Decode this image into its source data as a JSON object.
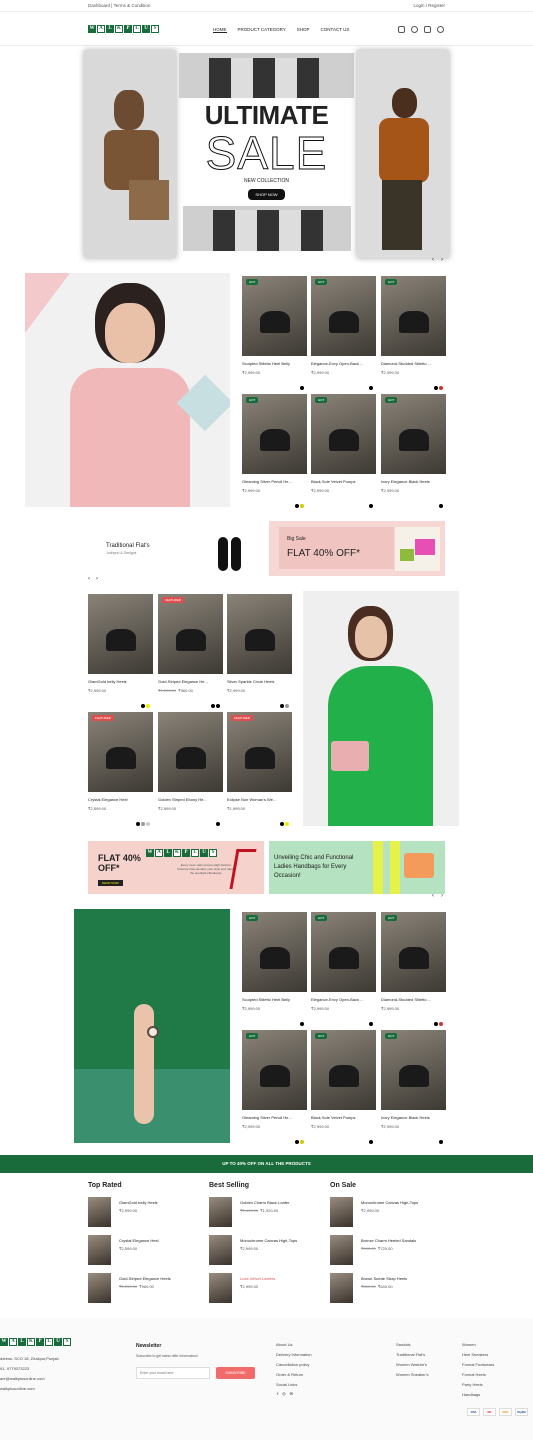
{
  "topbar": {
    "left": "Dashboard | Terms & Condition",
    "right": "Login / Register"
  },
  "brand": {
    "letters": [
      "W",
      "A",
      "L",
      "K",
      "P",
      "L",
      "U",
      "S"
    ]
  },
  "nav": [
    "HOME",
    "PRODUCT CATEGORY",
    "SHOP",
    "CONTACT US"
  ],
  "hero": {
    "title": "ULTIMATE",
    "title2": "SALE",
    "subtitle": "NEW COLLECTION",
    "cta": "SHOP NOW"
  },
  "products1": [
    {
      "name": "Sculpted Stiletto Heel Belly",
      "price": "₹2,999.00",
      "badge": "HOT",
      "dots": [
        "#000"
      ]
    },
    {
      "name": "Elegance-Envy Open-Back ...",
      "price": "₹2,999.00",
      "badge": "HOT",
      "dots": [
        "#000"
      ]
    },
    {
      "name": "Diamond-Studded Stiletto ...",
      "price": "₹2,999.00",
      "badge": "HOT",
      "dots": [
        "#000",
        "#c33"
      ]
    },
    {
      "name": "Gleaming Silver Pencil He...",
      "price": "₹2,999.00",
      "badge": "HOT",
      "dots": [
        "#000",
        "#cc0"
      ]
    },
    {
      "name": "Black Sole Velvet Pumps",
      "price": "₹2,999.00",
      "badge": "HOT",
      "dots": [
        "#000"
      ]
    },
    {
      "name": "Ivory Elegance Black Heels",
      "price": "₹2,999.00",
      "badge": "HOT",
      "dots": [
        "#000"
      ]
    }
  ],
  "flats": {
    "title": "Traditional Flat's",
    "subtitle": "Jodhpuri & Designs"
  },
  "bigsale": {
    "title": "Big Sale",
    "offer": "FLAT 40% OFF*"
  },
  "products2": [
    {
      "name": "GlamGold belly Heels",
      "price": "₹2,999.00",
      "badge": "",
      "dots": [
        "#000",
        "#ee0"
      ]
    },
    {
      "name": "Gold-Striped Elegance He...",
      "old": "₹1,200.00",
      "price": "₹960.00",
      "badge": "FEATURED",
      "dots": [
        "#000",
        "#000"
      ]
    },
    {
      "name": "Silver Sparkle Circle Heels",
      "price": "₹2,999.00",
      "badge": "",
      "dots": [
        "#000",
        "#999"
      ]
    },
    {
      "name": "Crystal Elegance Heel",
      "price": "₹2,599.00",
      "badge": "FEATURED",
      "dots": [
        "#000",
        "#999",
        "#ccc"
      ]
    },
    {
      "name": "Golden Striped Ebony He...",
      "price": "₹2,999.00",
      "badge": "",
      "dots": [
        "#000"
      ]
    },
    {
      "name": "Eclipse Noir Woman's We...",
      "price": "₹1,999.00",
      "badge": "FEATURED",
      "dots": [
        "#000",
        "#ee0"
      ]
    }
  ],
  "promo1": {
    "offer": "FLAT 40% OFF*",
    "desc": "Every heel: Harmonious High Fashion footwear that elevates your style and raises the spotlight effortlessly.",
    "cta": "SHOP NOW"
  },
  "promo2": {
    "text": "Unveiling Chic and Functional Ladies Handbags for Every Occasion!",
    "tag": "SHOP NOW"
  },
  "products3": [
    {
      "name": "Sculpted Stiletto Heel Belly",
      "price": "₹2,999.00",
      "badge": "HOT",
      "dots": [
        "#000"
      ]
    },
    {
      "name": "Elegance-Envy Open-Back ...",
      "price": "₹2,999.00",
      "badge": "HOT",
      "dots": [
        "#000"
      ]
    },
    {
      "name": "Diamond-Studded Stiletto ...",
      "price": "₹2,999.00",
      "badge": "HOT",
      "dots": [
        "#000",
        "#c33"
      ]
    },
    {
      "name": "Gleaming Silver Pencil He...",
      "price": "₹2,999.00",
      "badge": "HOT",
      "dots": [
        "#000",
        "#cc0"
      ]
    },
    {
      "name": "Black Sole Velvet Pumps",
      "price": "₹2,999.00",
      "badge": "HOT",
      "dots": [
        "#000"
      ]
    },
    {
      "name": "Ivory Elegance Black Heels",
      "price": "₹2,999.00",
      "badge": "HOT",
      "dots": [
        "#000"
      ]
    }
  ],
  "banner": "UP TO 40% OFF ON ALL THE PRODUCTS",
  "top_rated": {
    "title": "Top Rated",
    "items": [
      {
        "n": "GlamGold belly Heels",
        "p": "₹2,999.00",
        "o": ""
      },
      {
        "n": "Crystal Elegance Heel",
        "p": "₹2,599.00",
        "o": ""
      },
      {
        "n": "Gold-Striped Elegance Heels",
        "p": "₹960.00",
        "o": "₹1,200.00"
      }
    ]
  },
  "best_selling": {
    "title": "Best Selling",
    "items": [
      {
        "n": "Golden Charm Black Loafer",
        "p": "₹1,920.00",
        "o": "₹2,400.00"
      },
      {
        "n": "Monochrome Canvas High-Tops",
        "p": "₹2,999.00",
        "o": ""
      },
      {
        "n": "Luxe Velvet Loafers",
        "p": "₹2,999.00",
        "o": ""
      }
    ]
  },
  "on_sale": {
    "title": "On Sale",
    "items": [
      {
        "n": "Monochrome Canvas High-Tops",
        "p": "₹2,999.00",
        "o": ""
      },
      {
        "n": "Bronze Charm Heeled Sandals",
        "p": "₹720.00",
        "o": "₹900.00"
      },
      {
        "n": "Brown Suede Strap Heels",
        "p": "₹640.00",
        "o": "₹800.00"
      }
    ]
  },
  "footer": {
    "address": [
      "ddress: SCO 18, Zirakpur,Punjab",
      "91- 9779373223",
      "are@walkplusonline.com",
      "walkplusonline.com"
    ],
    "newsletter_title": "Newsletter",
    "newsletter_desc": "Subscribe to get latest offer information!",
    "email_placeholder": "Enter your email here",
    "subscribe": "SUBSCRIBE",
    "col1": [
      "About Us",
      "Delivery Information",
      "Cancellation policy",
      "Order & Return",
      "Social Links"
    ],
    "col2": [
      "Sandals",
      "Traditional Flat's",
      "Women Watche's",
      "Women Sneaker's"
    ],
    "col3": [
      "Women",
      "Heel Sneakers",
      "Formal Footwears",
      "Formal Heels",
      "Party Heels",
      "Handbags"
    ],
    "payments": [
      "VISA",
      "MC",
      "DISC",
      "PayPal"
    ]
  }
}
